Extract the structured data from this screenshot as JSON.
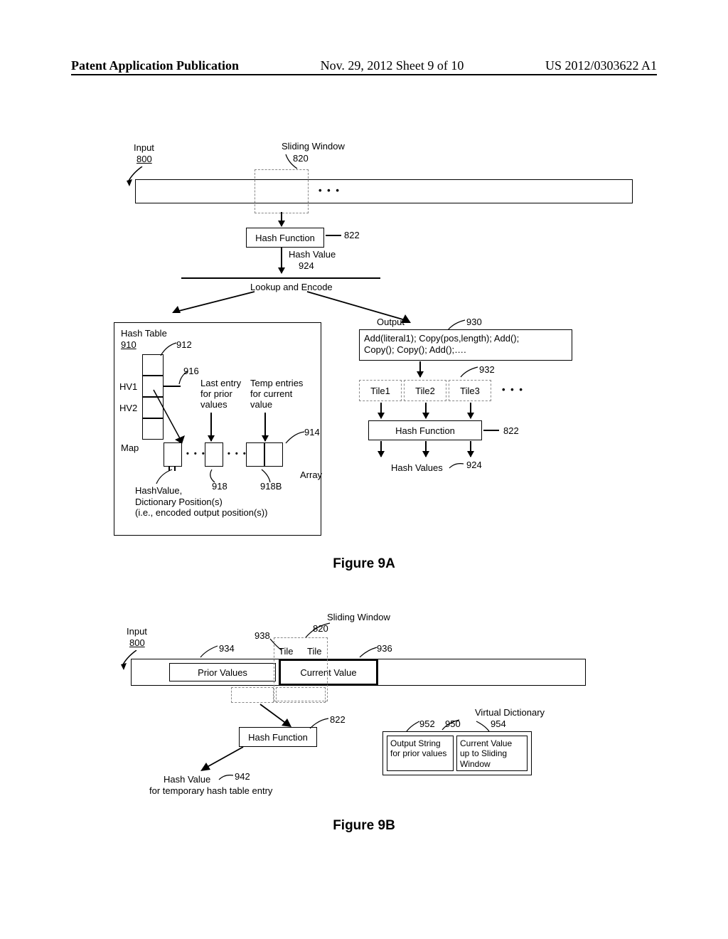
{
  "header": {
    "left": "Patent Application Publication",
    "middle": "Nov. 29, 2012  Sheet 9 of 10",
    "right": "US 2012/0303622 A1"
  },
  "figA": {
    "title": "Figure 9A",
    "input": {
      "label": "Input",
      "num": "800"
    },
    "sliding_window": {
      "label": "Sliding Window",
      "num": "820"
    },
    "dots": "• • •",
    "hash_fn": {
      "label": "Hash Function",
      "num": "822"
    },
    "hash_val": {
      "label": "Hash Value",
      "num": "924"
    },
    "lookup": "Lookup and Encode",
    "hash_table": {
      "label": "Hash Table",
      "num": "910",
      "col_num": "912",
      "entry_num": "916"
    },
    "hv1": "HV1",
    "hv2": "HV2",
    "map_label": "Map",
    "prior_entries": {
      "line1": "Last entry",
      "line2": "for prior",
      "line3": "values"
    },
    "temp_entries": {
      "line1": "Temp entries",
      "line2": "for current",
      "line3": "value"
    },
    "array_num": "914",
    "array_label": "Array",
    "cell_num": "918",
    "cell_numB": "918B",
    "map_caption": {
      "l1": "HashValue,",
      "l2": "Dictionary Position(s)",
      "l3": "(i.e., encoded output position(s))"
    },
    "output": {
      "label": "Output",
      "num": "930",
      "line1": "Add(literal1); Copy(pos,length); Add();",
      "line2": "Copy(); Copy(); Add();…."
    },
    "tiles": {
      "num": "932",
      "t1": "Tile1",
      "t2": "Tile2",
      "t3": "Tile3",
      "dots": "• • •"
    },
    "hash_fn2": {
      "label": "Hash Function",
      "num": "822"
    },
    "hash_vals2": {
      "label": "Hash Values",
      "num": "924"
    }
  },
  "figB": {
    "title": "Figure 9B",
    "input": {
      "label": "Input",
      "num": "800"
    },
    "sliding_window": {
      "label": "Sliding Window",
      "num": "820"
    },
    "prior_label": "Prior Values",
    "prior_num": "934",
    "current_label": "Current Value",
    "current_num": "936",
    "tile_left": "Tile",
    "tile_right": "Tile",
    "tile_num": "938",
    "hash_fn": {
      "label": "Hash Function",
      "num": "822"
    },
    "hash_val": {
      "label": "Hash Value",
      "num": "942",
      "caption": "for temporary hash table entry"
    },
    "vdict": {
      "label": "Virtual Dictionary",
      "num": "950"
    },
    "out_prior": {
      "l1": "Output String",
      "l2": "for prior values",
      "num": "952"
    },
    "cur_to_slide": {
      "l1": "Current Value",
      "l2": "up to Sliding",
      "l3": "Window",
      "num": "954"
    }
  }
}
